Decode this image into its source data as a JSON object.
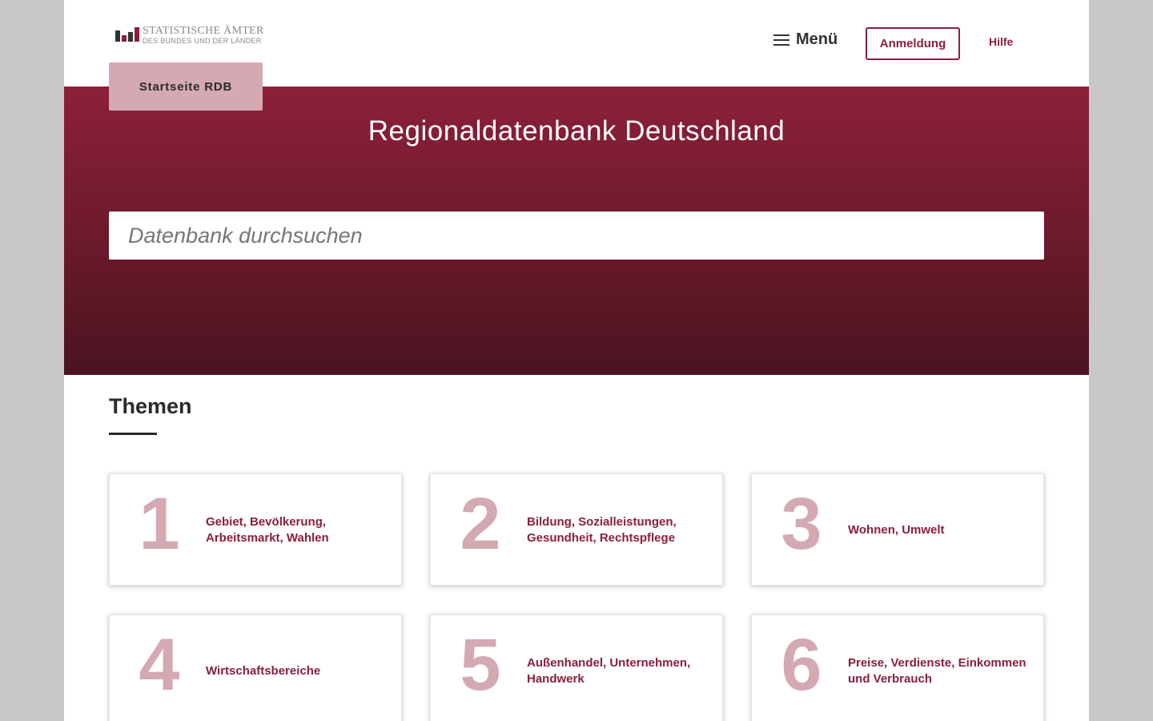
{
  "header": {
    "logo": {
      "line1": "STATISTISCHE ÄMTER",
      "line2": "DES BUNDES UND DER LÄNDER",
      "colors": [
        "#333333",
        "#8b1f3a",
        "#333333",
        "#8b1f3a"
      ]
    },
    "menu_label": "Menü",
    "login_label": "Anmeldung",
    "help_label": "Hilfe"
  },
  "start_button_label": "Startseite RDB",
  "hero": {
    "title": "Regionaldatenbank Deutschland",
    "search_placeholder": "Datenbank durchsuchen"
  },
  "themes": {
    "title": "Themen",
    "cards": [
      {
        "number": "1",
        "label": "Gebiet, Bevölkerung, Arbeitsmarkt, Wahlen"
      },
      {
        "number": "2",
        "label": "Bildung, Sozialleistungen, Gesundheit, Rechtspflege"
      },
      {
        "number": "3",
        "label": "Wohnen, Umwelt"
      },
      {
        "number": "4",
        "label": "Wirtschaftsbereiche"
      },
      {
        "number": "5",
        "label": "Außenhandel, Unternehmen, Handwerk"
      },
      {
        "number": "6",
        "label": "Preise, Verdienste, Einkommen und Verbrauch"
      }
    ]
  },
  "colors": {
    "accent": "#8b1f3a",
    "accent_light": "#d4a9b2",
    "hero_top": "#8c2039",
    "hero_bottom": "#4a1420"
  }
}
